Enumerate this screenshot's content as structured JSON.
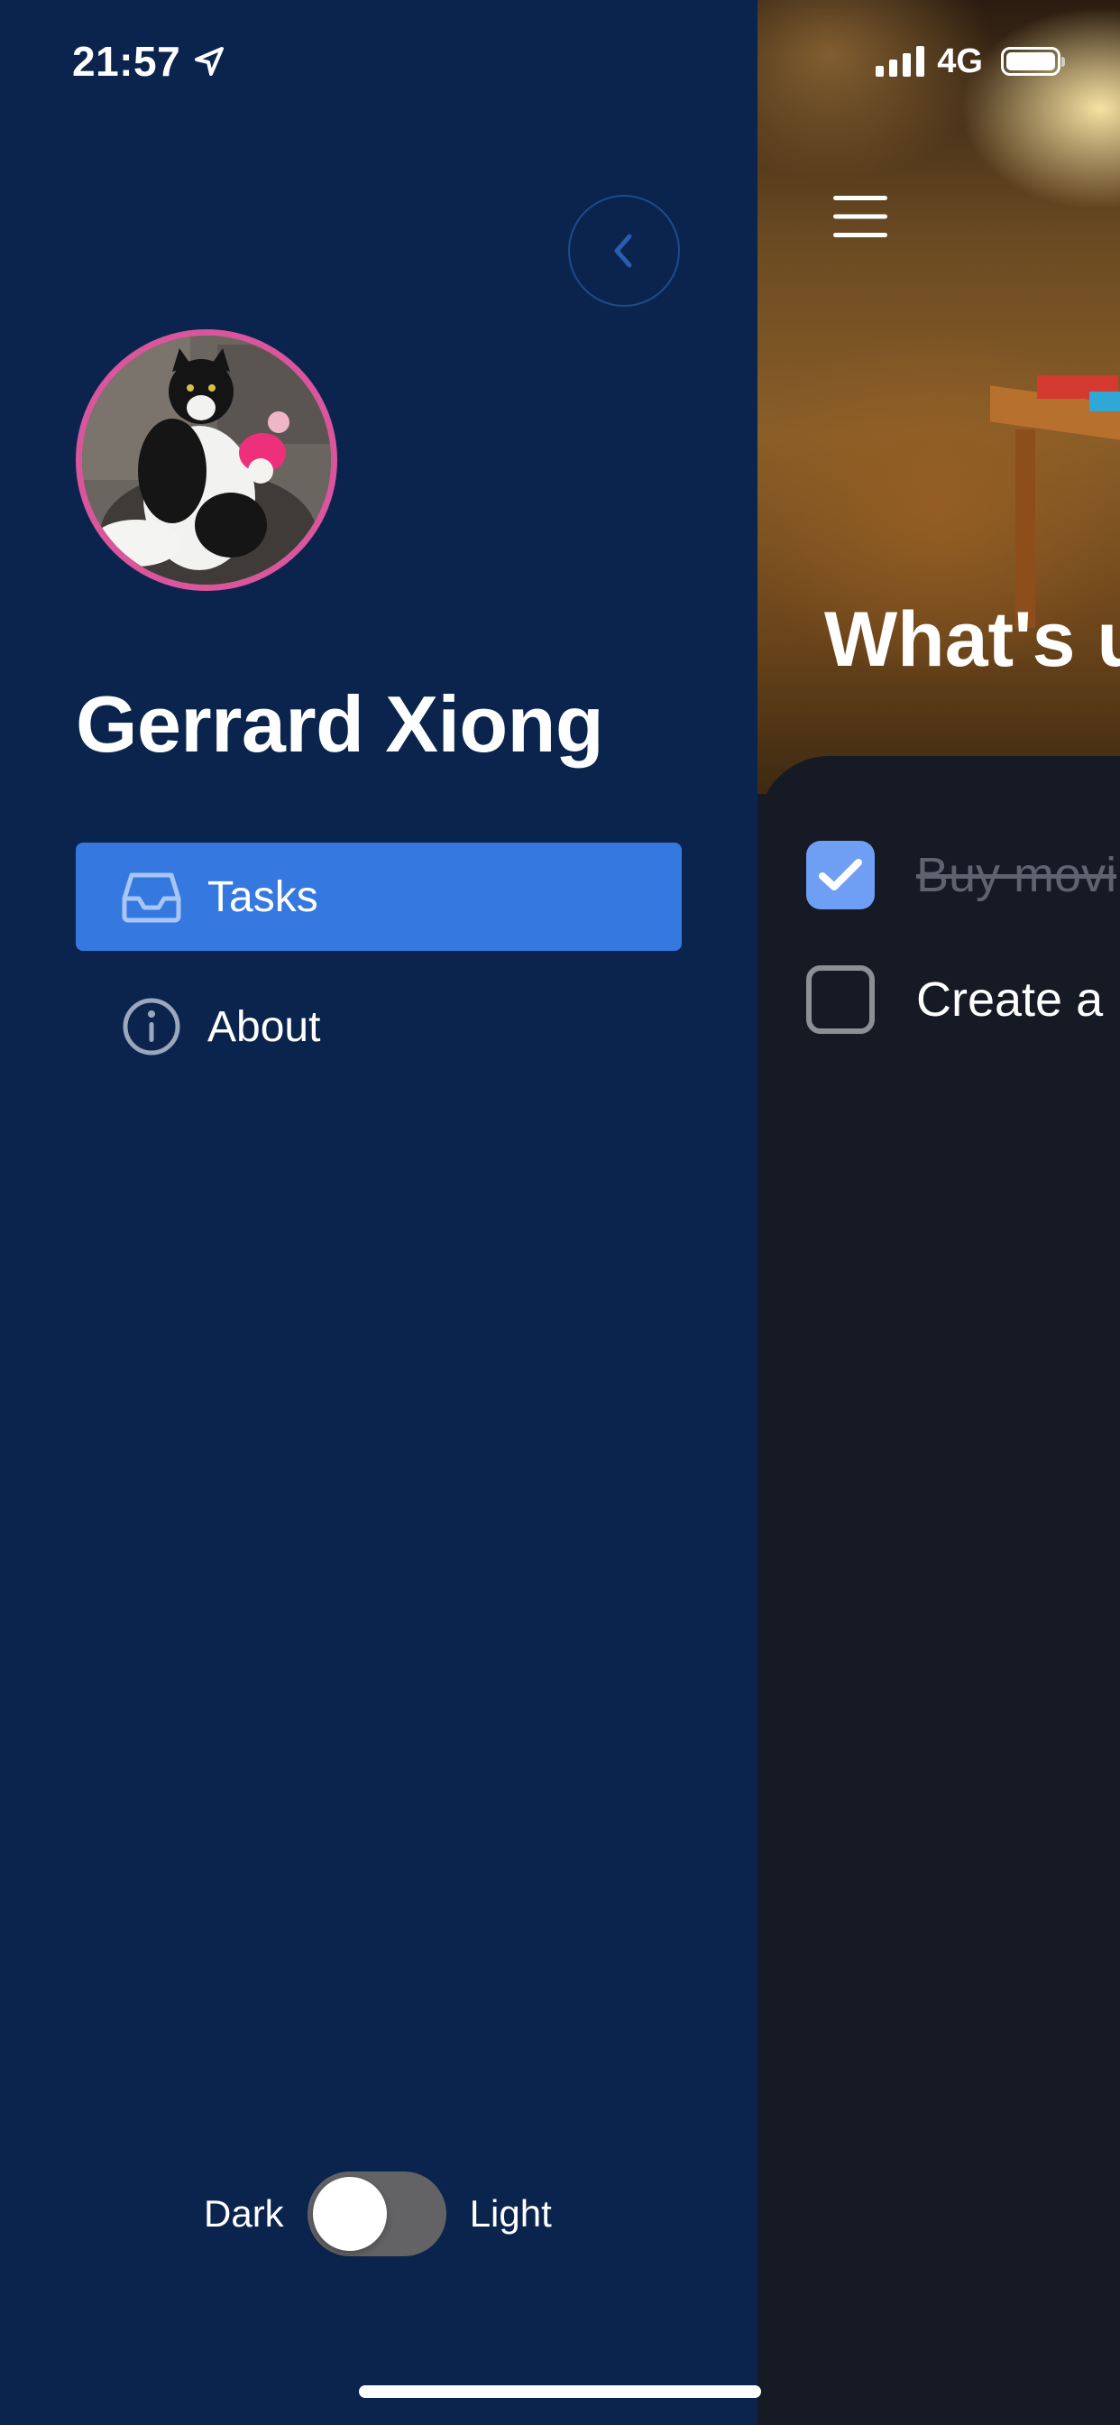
{
  "status_bar": {
    "time": "21:57",
    "location_icon": "location-arrow-icon",
    "network": "4G",
    "signal_bars": 4,
    "battery_level": 1.0
  },
  "drawer": {
    "close_icon": "chevron-left-icon",
    "avatar_icon": "cat-photo",
    "user_name": "Gerrard Xiong",
    "nav": [
      {
        "label": "Tasks",
        "icon": "inbox-icon",
        "active": true
      },
      {
        "label": "About",
        "icon": "info-circle-icon",
        "active": false
      }
    ],
    "theme": {
      "dark_label": "Dark",
      "light_label": "Light",
      "is_light": false
    }
  },
  "main": {
    "menu_icon": "hamburger-menu-icon",
    "title": "What's u",
    "tasks": [
      {
        "label": "Buy movi",
        "done": true
      },
      {
        "label": "Create a",
        "done": false
      }
    ]
  },
  "colors": {
    "drawer_bg": "#0b244d",
    "accent": "#3578e0",
    "avatar_ring": "#d9569c",
    "main_bg": "#151a24",
    "checkbox_checked": "#6e9ff5"
  }
}
